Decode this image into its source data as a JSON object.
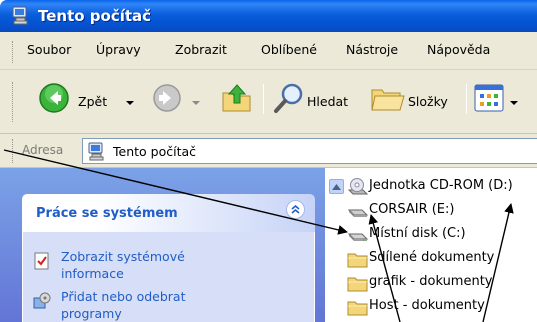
{
  "window": {
    "title": "Tento počítač",
    "title_icon": "my-computer-icon"
  },
  "menubar": {
    "items": [
      "Soubor",
      "Úpravy",
      "Zobrazit",
      "Oblíbené",
      "Nástroje",
      "Nápověda"
    ]
  },
  "toolbar": {
    "back_label": "Zpět",
    "back_icon": "back-arrow-icon",
    "forward_icon": "forward-arrow-icon",
    "up_icon": "up-folder-icon",
    "search_label": "Hledat",
    "search_icon": "magnifier-icon",
    "folders_label": "Složky",
    "folders_icon": "folders-icon",
    "views_icon": "views-icon"
  },
  "address": {
    "label": "Adresa",
    "value": "Tento počítač",
    "icon": "my-computer-icon"
  },
  "task_pane": {
    "title": "Práce se systémem",
    "tasks": [
      {
        "label": "Zobrazit systémové informace",
        "lines": [
          "Zobrazit systémové",
          "informace"
        ],
        "icon": "system-info-icon"
      },
      {
        "label": "Přidat nebo odebrat programy",
        "lines": [
          "Přidat nebo odebrat",
          "programy"
        ],
        "icon": "add-remove-programs-icon"
      }
    ]
  },
  "files": [
    {
      "name": "Jednotka CD-ROM (D:)",
      "icon": "cd-drive-icon"
    },
    {
      "name": "CORSAIR (E:)",
      "icon": "removable-drive-icon"
    },
    {
      "name": "Místní disk (C:)",
      "icon": "hard-disk-icon"
    },
    {
      "name": "Sdílené dokumenty",
      "icon": "folder-icon"
    },
    {
      "name": "grafik - dokumenty",
      "icon": "folder-icon"
    },
    {
      "name": "Host - dokumenty",
      "icon": "folder-icon"
    }
  ],
  "colors": {
    "title_bar": "#0a5ddb",
    "toolbar_bg": "#ece9d8",
    "task_pane_bg": "#7ba2e7",
    "task_link": "#215dc6",
    "folder": "#f4d67a",
    "annotation_line": "#000000"
  }
}
